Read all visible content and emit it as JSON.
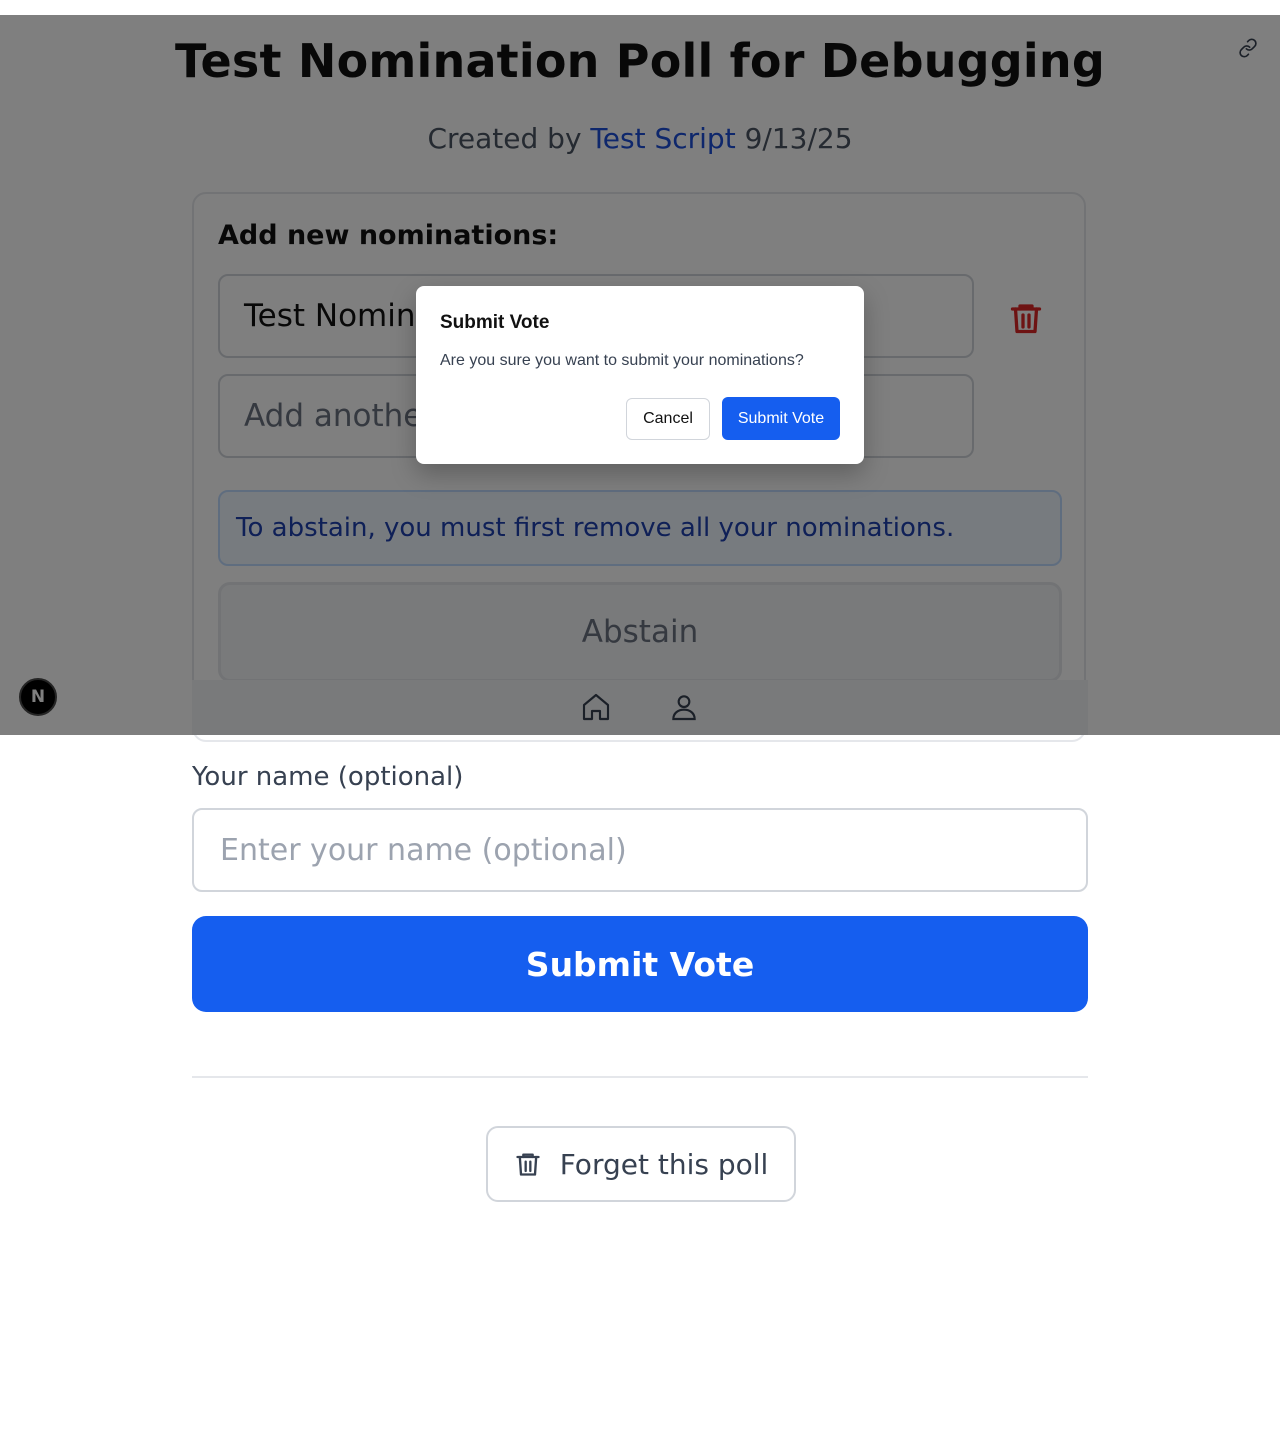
{
  "header": {
    "corner_text": "",
    "title": "Test Nomination Poll for Debugging",
    "byline_prefix": "Created by",
    "author": "Test Script",
    "date": "9/13/25",
    "share_icon": "link-icon"
  },
  "nominations": {
    "heading": "Add new nominations:",
    "entries": [
      {
        "value": "Test Nomination",
        "delete_icon": "trash-icon"
      }
    ],
    "add_placeholder": "Add another nomination...",
    "info": "To abstain, you must first remove all your nominations.",
    "abstain_label": "Abstain"
  },
  "bottom_nav": {
    "items": [
      {
        "icon": "home-icon"
      },
      {
        "icon": "user-icon"
      }
    ]
  },
  "dev_badge": {
    "label": "N"
  },
  "modal": {
    "title": "Submit Vote",
    "message": "Are you sure you want to submit your nominations?",
    "cancel_label": "Cancel",
    "confirm_label": "Submit Vote"
  },
  "voter": {
    "name_label": "Your name (optional)",
    "name_placeholder": "Enter your name (optional)",
    "name_value": ""
  },
  "actions": {
    "submit_label": "Submit Vote",
    "forget_label": "Forget this poll",
    "forget_icon": "trash-icon"
  },
  "colors": {
    "accent": "#155eef",
    "author_link": "#1d4ed8",
    "danger": "#dc2626",
    "info_text": "#1e40af",
    "overlay": "rgba(0,0,0,0.5)"
  }
}
